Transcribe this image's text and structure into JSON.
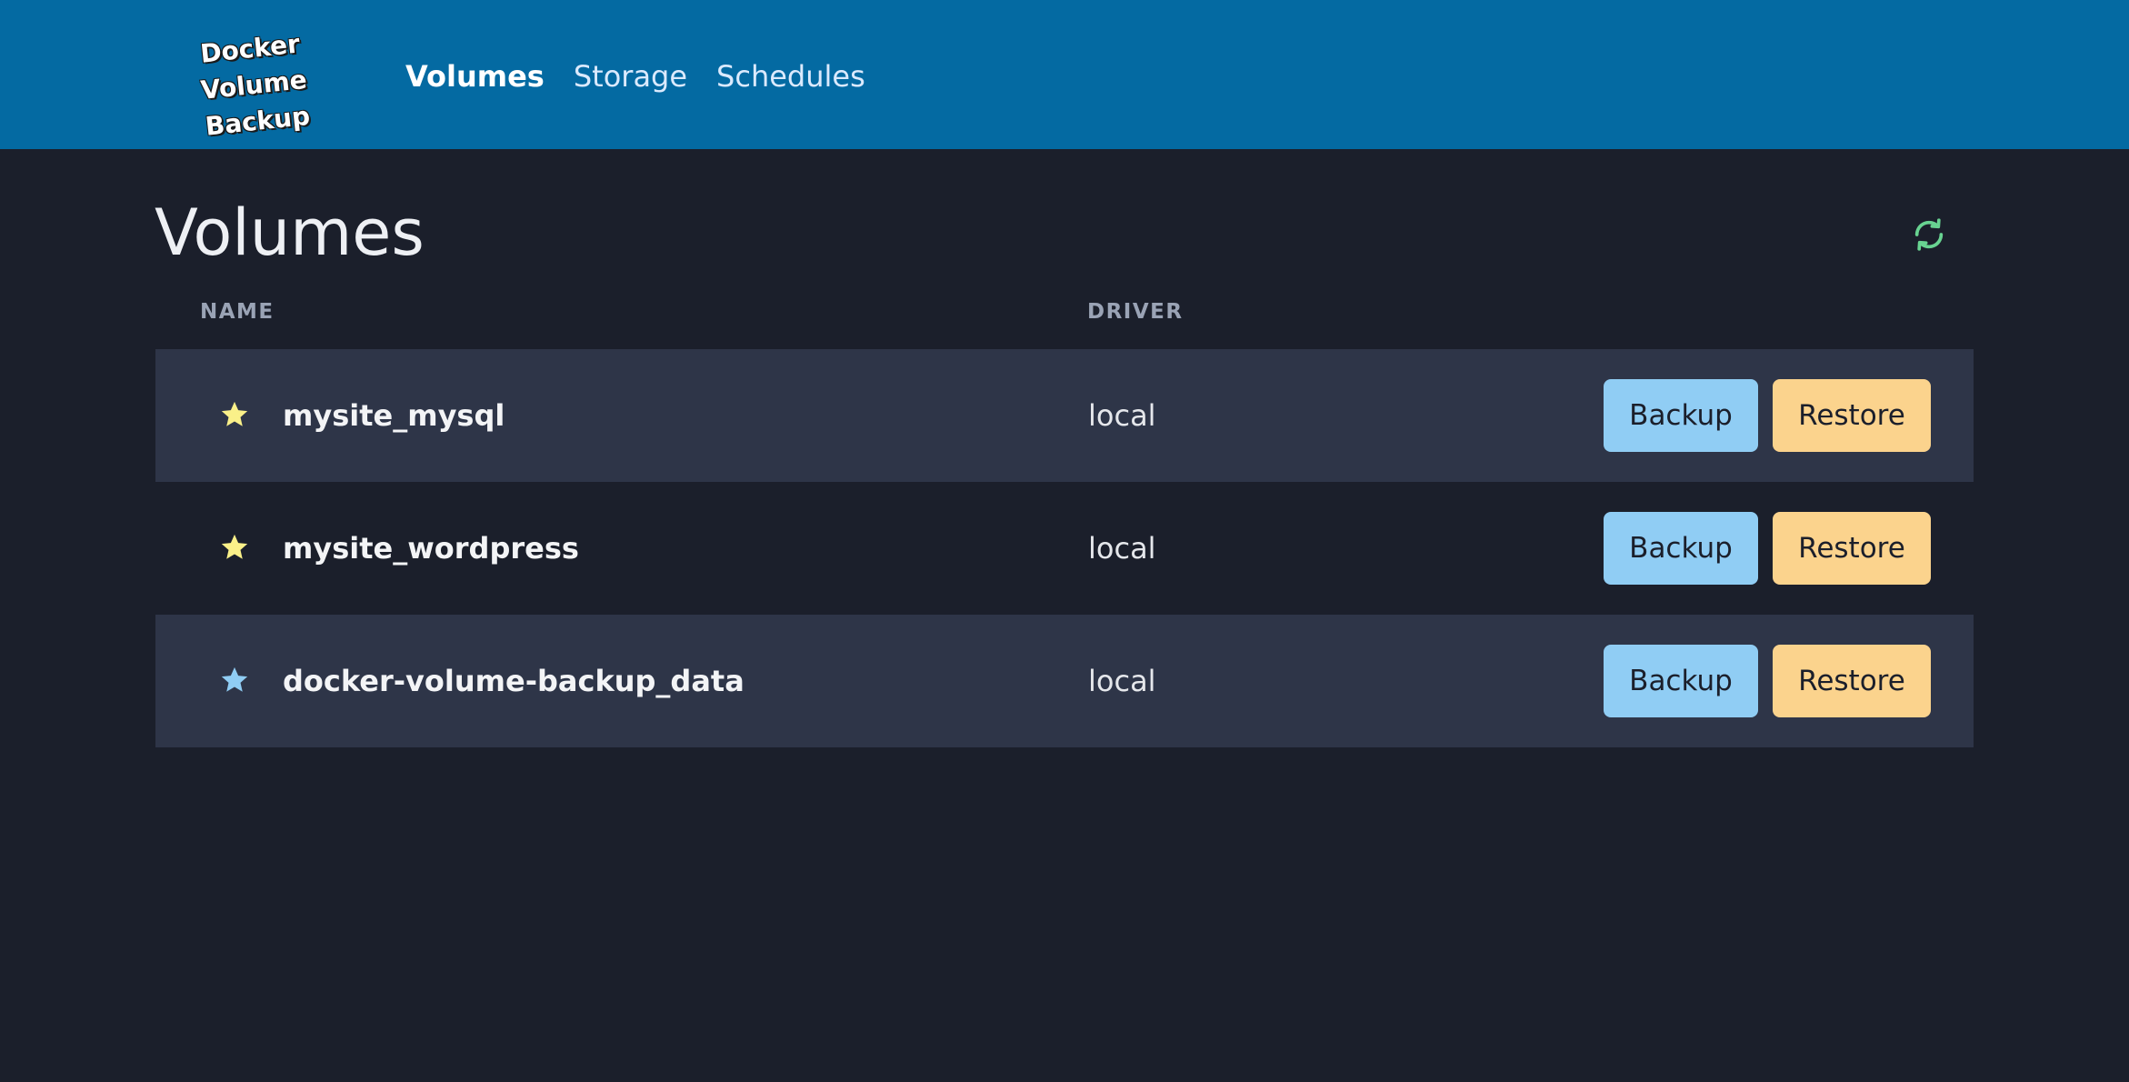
{
  "app": {
    "logo_line1": "Docker Volume",
    "logo_line2": "Backup"
  },
  "nav": {
    "items": [
      {
        "label": "Volumes",
        "active": true
      },
      {
        "label": "Storage",
        "active": false
      },
      {
        "label": "Schedules",
        "active": false
      }
    ]
  },
  "page": {
    "title": "Volumes",
    "refresh_icon": "refresh-icon"
  },
  "table": {
    "columns": [
      "NAME",
      "DRIVER"
    ],
    "rows": [
      {
        "name": "mysite_mysql",
        "driver": "local",
        "star_color": "#faf089",
        "backup_label": "Backup",
        "restore_label": "Restore"
      },
      {
        "name": "mysite_wordpress",
        "driver": "local",
        "star_color": "#faf089",
        "backup_label": "Backup",
        "restore_label": "Restore"
      },
      {
        "name": "docker-volume-backup_data",
        "driver": "local",
        "star_color": "#90cdf4",
        "backup_label": "Backup",
        "restore_label": "Restore"
      }
    ]
  },
  "colors": {
    "header_bg": "#046aa2",
    "page_bg": "#1b1f2b",
    "row_alt_bg": "#2e3548",
    "backup_btn": "#90cdf4",
    "restore_btn": "#fbd38d",
    "refresh_icon": "#68d391"
  }
}
